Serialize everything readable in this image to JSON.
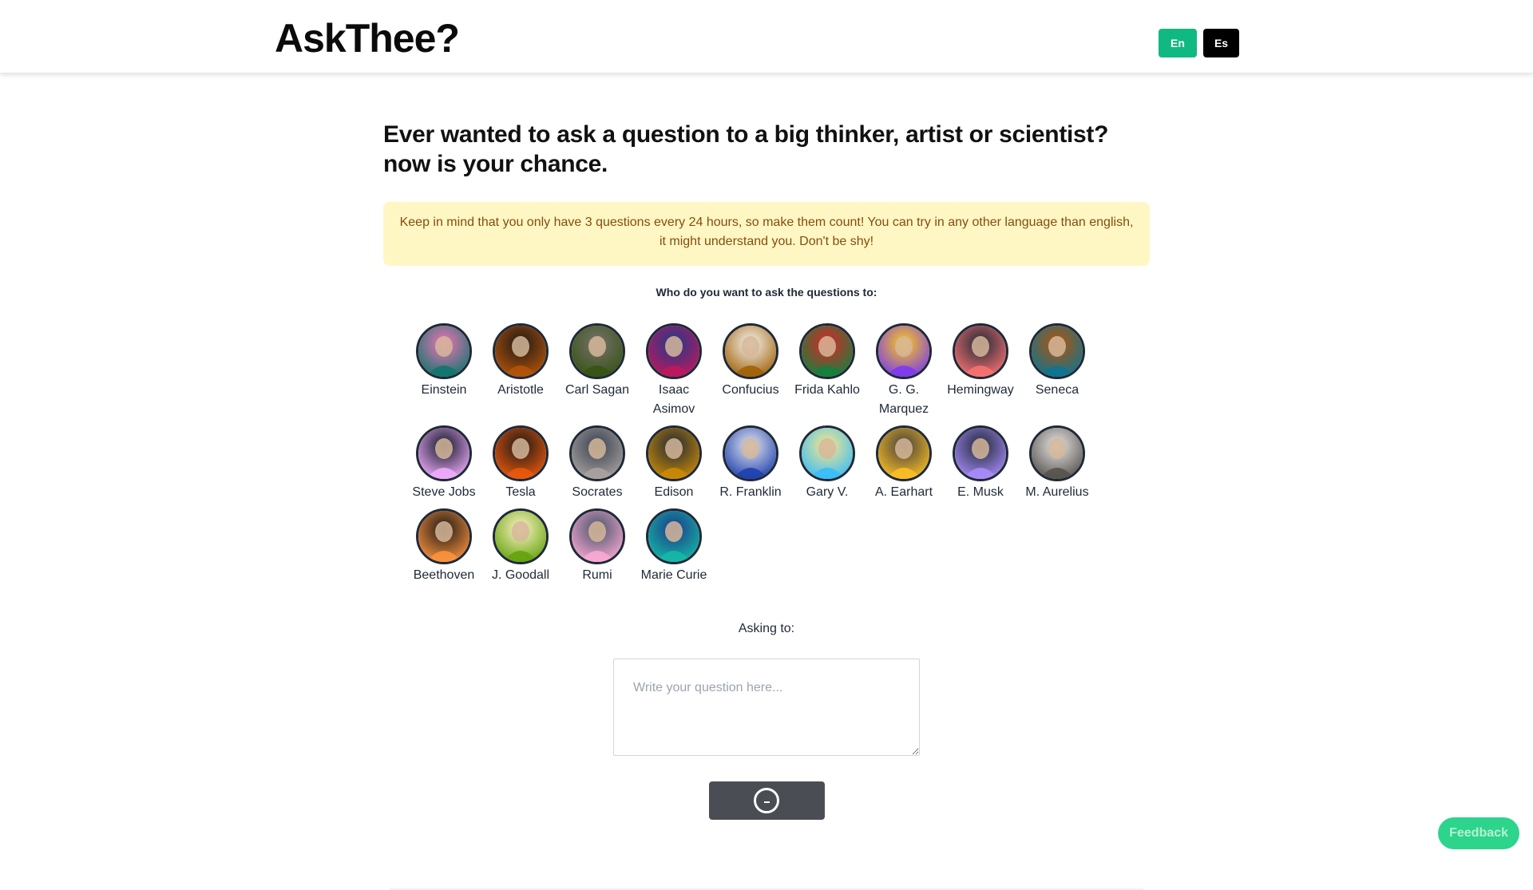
{
  "header": {
    "logo": "AskThee?",
    "languages": [
      {
        "label": "En",
        "color": "#10b981"
      },
      {
        "label": "Es",
        "color": "#000000"
      }
    ]
  },
  "main": {
    "headline": "Ever wanted to ask a question to a big thinker, artist or scientist? now is your chance.",
    "notice": "Keep in mind that you only have 3 questions every 24 hours, so make them count!  You can try in any other language than english, it might understand you. Don't be shy!",
    "who_label": "Who do you want to ask the questions to:",
    "thinkers": [
      {
        "name": "Einstein",
        "slug": "einstein",
        "c1": "#0f766e",
        "c2": "#f472b6"
      },
      {
        "name": "Aristotle",
        "slug": "aristotle",
        "c1": "#b45309",
        "c2": "#1c1917"
      },
      {
        "name": "Carl Sagan",
        "slug": "carl-sagan",
        "c1": "#365314",
        "c2": "#78716c"
      },
      {
        "name": "Isaac Asimov",
        "slug": "isaac-asimov",
        "c1": "#be185d",
        "c2": "#1e3a8a"
      },
      {
        "name": "Confucius",
        "slug": "confucius",
        "c1": "#a16207",
        "c2": "#f5f5f4"
      },
      {
        "name": "Frida Kahlo",
        "slug": "frida-kahlo",
        "c1": "#15803d",
        "c2": "#dc2626"
      },
      {
        "name": "G. G. Marquez",
        "slug": "g-g-marquez",
        "c1": "#7c3aed",
        "c2": "#facc15"
      },
      {
        "name": "Hemingway",
        "slug": "hemingway",
        "c1": "#f87171",
        "c2": "#1f2937"
      },
      {
        "name": "Seneca",
        "slug": "seneca",
        "c1": "#0e7490",
        "c2": "#b45309"
      },
      {
        "name": "Steve Jobs",
        "slug": "steve-jobs",
        "c1": "#f0abfc",
        "c2": "#111827"
      },
      {
        "name": "Tesla",
        "slug": "tesla",
        "c1": "#ea580c",
        "c2": "#1c1917"
      },
      {
        "name": "Socrates",
        "slug": "socrates",
        "c1": "#a8a29e",
        "c2": "#374151"
      },
      {
        "name": "Edison",
        "slug": "edison",
        "c1": "#ca8a04",
        "c2": "#1f2937"
      },
      {
        "name": "R. Franklin",
        "slug": "r-franklin",
        "c1": "#1e40af",
        "c2": "#e5e7eb"
      },
      {
        "name": "Gary V.",
        "slug": "gary-v",
        "c1": "#38bdf8",
        "c2": "#fde68a"
      },
      {
        "name": "A. Earhart",
        "slug": "a-earhart",
        "c1": "#fbbf24",
        "c2": "#44403c"
      },
      {
        "name": "E. Musk",
        "slug": "e-musk",
        "c1": "#a78bfa",
        "c2": "#1f2937"
      },
      {
        "name": "M. Aurelius",
        "slug": "m-aurelius",
        "c1": "#57534e",
        "c2": "#e7e5e4"
      },
      {
        "name": "Beethoven",
        "slug": "beethoven",
        "c1": "#fb923c",
        "c2": "#1c1917"
      },
      {
        "name": "J. Goodall",
        "slug": "j-goodall",
        "c1": "#65a30d",
        "c2": "#fef3c7"
      },
      {
        "name": "Rumi",
        "slug": "rumi",
        "c1": "#f9a8d4",
        "c2": "#475569"
      },
      {
        "name": "Marie Curie",
        "slug": "marie-curie",
        "c1": "#14b8a6",
        "c2": "#1e3a8a"
      }
    ],
    "asking_label": "Asking to:",
    "question_placeholder": "Write your question here...",
    "question_value": ""
  },
  "feedback": {
    "label": "Feedback",
    "color": "#2dd48b"
  }
}
